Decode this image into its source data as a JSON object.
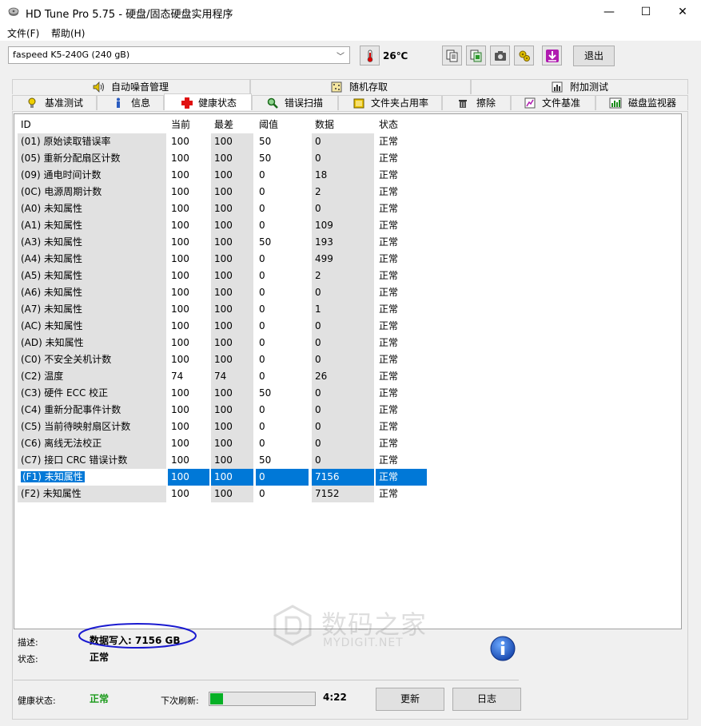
{
  "window": {
    "title": "HD Tune Pro 5.75 - 硬盘/固态硬盘实用程序",
    "controls": {
      "minimize": "—",
      "maximize": "☐",
      "close": "✕"
    }
  },
  "menu": {
    "file": "文件(F)",
    "help": "帮助(H)"
  },
  "toolbar": {
    "drive": "faspeed K5-240G (240 gB)",
    "temperature": "26℃",
    "exit_label": "退出",
    "icons": [
      "thermometer-icon",
      "copy-text-icon",
      "copy-screen-icon",
      "camera-icon",
      "settings-icon",
      "download-icon"
    ]
  },
  "tabs": {
    "row1": [
      {
        "label": "自动噪音管理",
        "icon": "speaker-icon"
      },
      {
        "label": "随机存取",
        "icon": "random-access-icon"
      },
      {
        "label": "附加测试",
        "icon": "extra-tests-icon"
      }
    ],
    "row2": [
      {
        "label": "基准测试",
        "icon": "benchmark-icon"
      },
      {
        "label": "信息",
        "icon": "info-icon"
      },
      {
        "label": "健康状态",
        "icon": "health-icon",
        "active": true
      },
      {
        "label": "错误扫描",
        "icon": "magnifier-icon"
      },
      {
        "label": "文件夹占用率",
        "icon": "folder-icon"
      },
      {
        "label": "擦除",
        "icon": "trash-icon"
      },
      {
        "label": "文件基准",
        "icon": "file-benchmark-icon"
      },
      {
        "label": "磁盘监视器",
        "icon": "monitor-icon"
      }
    ]
  },
  "smart": {
    "headers": {
      "id": "ID",
      "current": "当前",
      "worst": "最差",
      "threshold": "阈值",
      "data": "数据",
      "status": "状态"
    },
    "rows": [
      {
        "id": "(01) 原始读取错误率",
        "current": "100",
        "worst": "100",
        "threshold": "50",
        "data": "0",
        "status": "正常"
      },
      {
        "id": "(05) 重新分配扇区计数",
        "current": "100",
        "worst": "100",
        "threshold": "50",
        "data": "0",
        "status": "正常"
      },
      {
        "id": "(09) 通电时间计数",
        "current": "100",
        "worst": "100",
        "threshold": "0",
        "data": "18",
        "status": "正常"
      },
      {
        "id": "(0C) 电源周期计数",
        "current": "100",
        "worst": "100",
        "threshold": "0",
        "data": "2",
        "status": "正常"
      },
      {
        "id": "(A0) 未知属性",
        "current": "100",
        "worst": "100",
        "threshold": "0",
        "data": "0",
        "status": "正常"
      },
      {
        "id": "(A1) 未知属性",
        "current": "100",
        "worst": "100",
        "threshold": "0",
        "data": "109",
        "status": "正常"
      },
      {
        "id": "(A3) 未知属性",
        "current": "100",
        "worst": "100",
        "threshold": "50",
        "data": "193",
        "status": "正常"
      },
      {
        "id": "(A4) 未知属性",
        "current": "100",
        "worst": "100",
        "threshold": "0",
        "data": "499",
        "status": "正常"
      },
      {
        "id": "(A5) 未知属性",
        "current": "100",
        "worst": "100",
        "threshold": "0",
        "data": "2",
        "status": "正常"
      },
      {
        "id": "(A6) 未知属性",
        "current": "100",
        "worst": "100",
        "threshold": "0",
        "data": "0",
        "status": "正常"
      },
      {
        "id": "(A7) 未知属性",
        "current": "100",
        "worst": "100",
        "threshold": "0",
        "data": "1",
        "status": "正常"
      },
      {
        "id": "(AC) 未知属性",
        "current": "100",
        "worst": "100",
        "threshold": "0",
        "data": "0",
        "status": "正常"
      },
      {
        "id": "(AD) 未知属性",
        "current": "100",
        "worst": "100",
        "threshold": "0",
        "data": "0",
        "status": "正常"
      },
      {
        "id": "(C0) 不安全关机计数",
        "current": "100",
        "worst": "100",
        "threshold": "0",
        "data": "0",
        "status": "正常"
      },
      {
        "id": "(C2) 温度",
        "current": "74",
        "worst": "74",
        "threshold": "0",
        "data": "26",
        "status": "正常"
      },
      {
        "id": "(C3) 硬件 ECC 校正",
        "current": "100",
        "worst": "100",
        "threshold": "50",
        "data": "0",
        "status": "正常"
      },
      {
        "id": "(C4) 重新分配事件计数",
        "current": "100",
        "worst": "100",
        "threshold": "0",
        "data": "0",
        "status": "正常"
      },
      {
        "id": "(C5) 当前待映射扇区计数",
        "current": "100",
        "worst": "100",
        "threshold": "0",
        "data": "0",
        "status": "正常"
      },
      {
        "id": "(C6) 离线无法校正",
        "current": "100",
        "worst": "100",
        "threshold": "0",
        "data": "0",
        "status": "正常"
      },
      {
        "id": "(C7) 接口 CRC 错误计数",
        "current": "100",
        "worst": "100",
        "threshold": "50",
        "data": "0",
        "status": "正常"
      },
      {
        "id": "(F1) 未知属性",
        "current": "100",
        "worst": "100",
        "threshold": "0",
        "data": "7156",
        "status": "正常",
        "selected": true
      },
      {
        "id": "(F2) 未知属性",
        "current": "100",
        "worst": "100",
        "threshold": "0",
        "data": "7152",
        "status": "正常"
      }
    ]
  },
  "details": {
    "description_label": "描述:",
    "description_value": "数据写入: 7156 GB",
    "status_label": "状态:",
    "status_value": "正常"
  },
  "footer": {
    "health_label": "健康状态:",
    "health_value": "正常",
    "next_refresh_label": "下次刷新:",
    "refresh_progress": 0.12,
    "timer": "4:22",
    "refresh_button": "更新",
    "log_button": "日志"
  },
  "watermark": {
    "text": "数码之家",
    "sub": "MYDIGIT.NET"
  },
  "colors": {
    "selection": "#0078d7",
    "ok_green": "#1a9a1a",
    "progress_green": "#06b025",
    "annotation_blue": "#1a1ad0"
  }
}
